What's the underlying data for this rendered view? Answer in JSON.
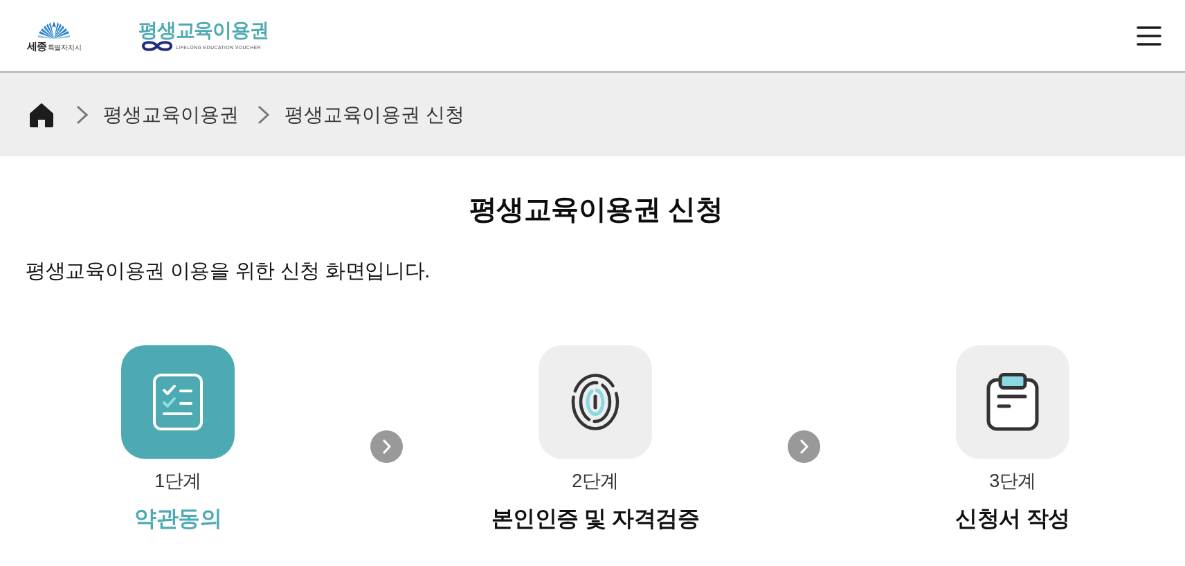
{
  "header": {
    "city_logo": {
      "name": "세종",
      "suffix": "특별자치시"
    },
    "voucher_logo": {
      "title": "평생교육이용권",
      "subtitle": "LIFELONG EDUCATION VOUCHER"
    }
  },
  "breadcrumb": [
    "평생교육이용권",
    "평생교육이용권 신청"
  ],
  "title": "평생교육이용권 신청",
  "description": "평생교육이용권 이용을 위한 신청 화면입니다.",
  "steps": [
    {
      "kind": "checklist",
      "label": "1단계",
      "name": "약관동의",
      "selected": true
    },
    {
      "kind": "fingerprint",
      "label": "2단계",
      "name": "본인인증 및 자격검증",
      "selected": false
    },
    {
      "kind": "clipboard",
      "label": "3단계",
      "name": "신청서 작성",
      "selected": false
    }
  ]
}
